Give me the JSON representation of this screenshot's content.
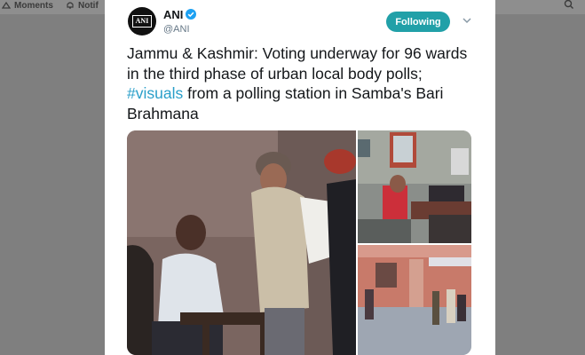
{
  "topnav": {
    "moments_label": "Moments",
    "notifications_label": "Notif"
  },
  "tweet": {
    "display_name": "ANI",
    "handle": "@ANI",
    "avatar_text": "ANI",
    "follow_label": "Following",
    "text_before": "Jammu & Kashmir: Voting underway for 96 wards in the third phase of urban local body polls; ",
    "hashtag": "#visuals",
    "text_after": " from a polling station in Samba's Bari Brahmana"
  },
  "colors": {
    "follow_button": "#21a0a8",
    "hashtag": "#2a9fc9",
    "verified": "#1da1f2",
    "overlay": "#7f7f7f"
  },
  "icons": [
    "moments-icon",
    "bell-icon",
    "search-icon",
    "verified-badge-icon",
    "chevron-down-icon"
  ]
}
